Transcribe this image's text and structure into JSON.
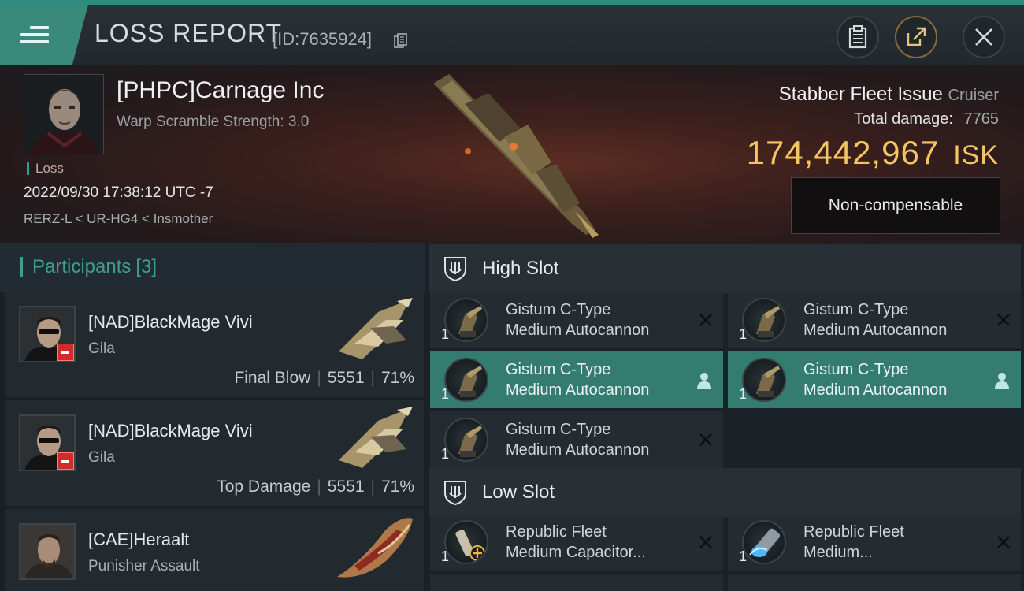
{
  "header": {
    "title": "LOSS REPORT",
    "report_id": "[ID:7635924]"
  },
  "victim": {
    "name": "[PHPC]Carnage Inc",
    "subtitle": "Warp Scramble Strength: 3.0",
    "tag": "Loss",
    "datetime": "2022/09/30 17:38:12 UTC -7",
    "location": "RERZ-L < UR-HG4 < Insmother",
    "ship_name": "Stabber Fleet Issue",
    "ship_class": "Cruiser",
    "total_damage_label": "Total damage:",
    "total_damage": "7765",
    "isk_value": "174,442,967",
    "isk_unit": "ISK",
    "compensation": "Non-compensable"
  },
  "participants": {
    "title": "Participants",
    "count": "[3]",
    "rows": [
      {
        "name": "[NAD]BlackMage Vivi",
        "ship": "Gila",
        "role": "Final Blow",
        "damage": "5551",
        "percent": "71%"
      },
      {
        "name": "[NAD]BlackMage Vivi",
        "ship": "Gila",
        "role": "Top Damage",
        "damage": "5551",
        "percent": "71%"
      },
      {
        "name": "[CAE]Heraalt",
        "ship": "Punisher Assault",
        "role": "",
        "damage": "",
        "percent": ""
      }
    ]
  },
  "fitting": {
    "high_slot_label": "High Slot",
    "low_slot_label": "Low Slot",
    "high_modules": [
      {
        "line1": "Gistum C-Type",
        "line2": "Medium Autocannon",
        "qty": "1",
        "state": "destroyed"
      },
      {
        "line1": "Gistum C-Type",
        "line2": "Medium Autocannon",
        "qty": "1",
        "state": "destroyed"
      },
      {
        "line1": "Gistum C-Type",
        "line2": "Medium Autocannon",
        "qty": "1",
        "state": "dropped"
      },
      {
        "line1": "Gistum C-Type",
        "line2": "Medium Autocannon",
        "qty": "1",
        "state": "dropped"
      },
      {
        "line1": "Gistum C-Type",
        "line2": "Medium Autocannon",
        "qty": "1",
        "state": "destroyed"
      }
    ],
    "low_modules": [
      {
        "line1": "Republic Fleet",
        "line2": "Medium Capacitor...",
        "qty": "1",
        "state": "destroyed"
      },
      {
        "line1": "Republic Fleet",
        "line2": "Medium...",
        "qty": "1",
        "state": "destroyed"
      }
    ]
  },
  "colors": {
    "accent": "#3a8a7c",
    "isk": "#f6c563",
    "active_module": "#357c70"
  }
}
